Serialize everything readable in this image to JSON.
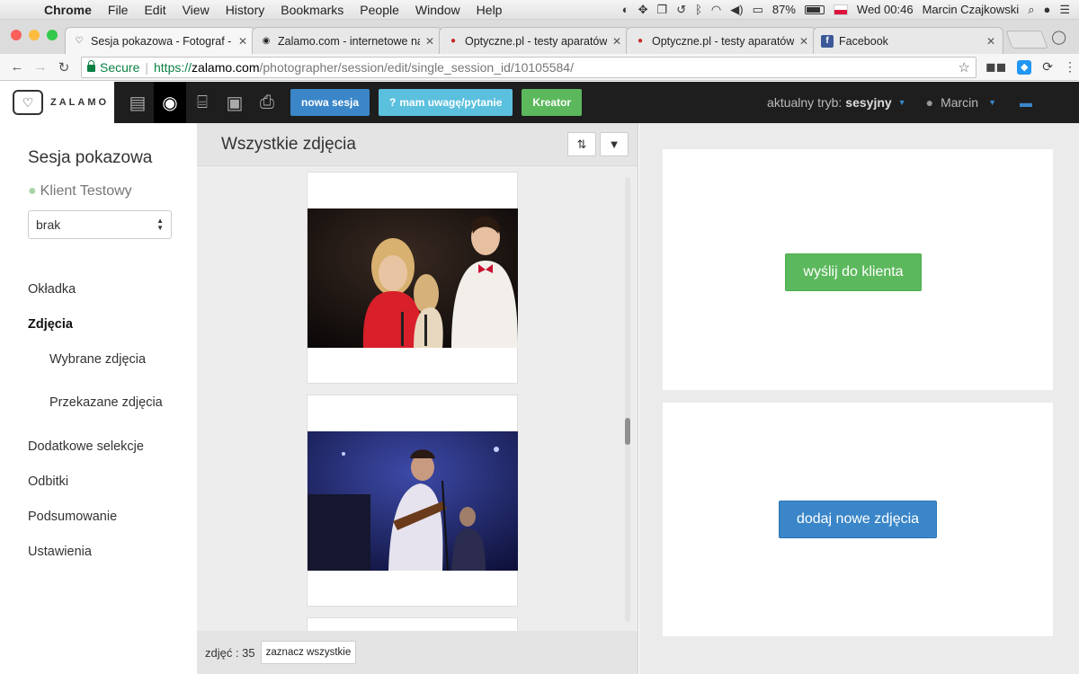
{
  "menubar": {
    "app": "Chrome",
    "items": [
      "File",
      "Edit",
      "View",
      "History",
      "Bookmarks",
      "People",
      "Window",
      "Help"
    ],
    "battery": "87%",
    "clock": "Wed 00:46",
    "user": "Marcin Czajkowski"
  },
  "tabs": [
    {
      "title": "Sesja pokazowa - Fotograf - z",
      "icon": "heart-icon"
    },
    {
      "title": "Zalamo.com - internetowe nar",
      "icon": "camera-icon"
    },
    {
      "title": "Optyczne.pl - testy aparatów,",
      "icon": "red-circle-icon"
    },
    {
      "title": "Optyczne.pl - testy aparatów,",
      "icon": "red-circle-icon"
    },
    {
      "title": "Facebook",
      "icon": "facebook-icon"
    }
  ],
  "address": {
    "secure": "Secure",
    "scheme": "https://",
    "host": "zalamo.com",
    "path": "/photographer/session/edit/single_session_id/10105584/"
  },
  "header": {
    "logo_text": "ZALAMO",
    "btn_new_session": "nowa sesja",
    "btn_feedback": "mam uwagę/pytanie",
    "btn_creator": "Kreator",
    "mode_label": "aktualny tryb:",
    "mode_value": "sesyjny",
    "user": "Marcin"
  },
  "sidebar": {
    "session_title": "Sesja pokazowa",
    "client": "Klient Testowy",
    "select_value": "brak",
    "items": [
      {
        "label": "Okładka"
      },
      {
        "label": "Zdjęcia"
      },
      {
        "label": "Wybrane zdjęcia"
      },
      {
        "label": "Przekazane zdjęcia"
      },
      {
        "label": "Dodatkowe selekcje"
      },
      {
        "label": "Odbitki"
      },
      {
        "label": "Podsumowanie"
      },
      {
        "label": "Ustawienia"
      }
    ]
  },
  "photos": {
    "heading": "Wszystkie zdjęcia",
    "count_label": "zdjęć : 35",
    "select_all": "zaznacz wszystkie"
  },
  "right": {
    "send_button": "wyślij do klienta",
    "add_button": "dodaj nowe zdjęcia"
  },
  "colors": {
    "green": "#5cb85c",
    "blue": "#3a86c8",
    "cyan": "#5bc0de",
    "header_bg": "#1e1e1e"
  }
}
